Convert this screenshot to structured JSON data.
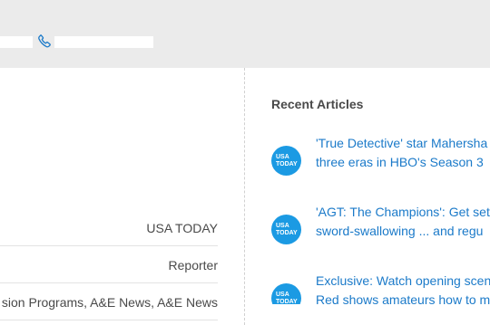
{
  "contact": {
    "field_left_value": "",
    "phone_value": "",
    "phone_icon": "phone-icon"
  },
  "details": {
    "rows": [
      {
        "value": "USA TODAY"
      },
      {
        "value": "Reporter"
      },
      {
        "value": "sion Programs, A&E News, A&E News"
      }
    ]
  },
  "sidebar": {
    "title": "Recent Articles",
    "badge_line1": "USA",
    "badge_line2": "TODAY",
    "articles": [
      {
        "line1": "'True Detective' star Mahersha",
        "line2": "three eras in HBO's Season 3"
      },
      {
        "line1": "'AGT: The Champions': Get set",
        "line2": "sword-swallowing ... and regu"
      },
      {
        "line1": "Exclusive: Watch opening scen",
        "line2": "Red shows amateurs how to m"
      }
    ]
  },
  "colors": {
    "link": "#1b7ac9",
    "badge": "#1b9ae3",
    "band": "#ebebeb"
  }
}
